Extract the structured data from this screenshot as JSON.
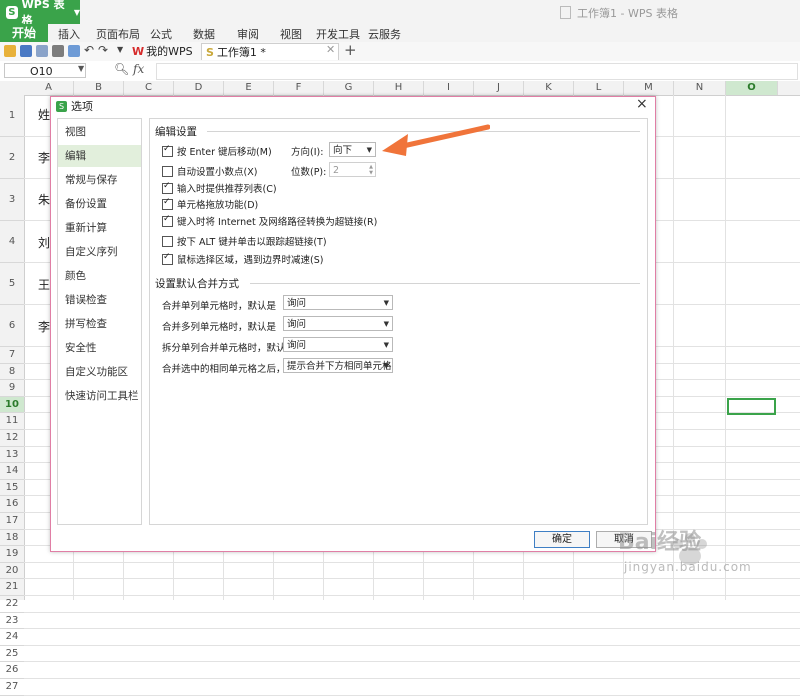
{
  "app": {
    "name": "WPS 表格",
    "window_title": "工作簿1 - WPS 表格"
  },
  "ribbon": {
    "tabs": [
      "开始",
      "插入",
      "页面布局",
      "公式",
      "数据",
      "审阅",
      "视图",
      "开发工具",
      "云服务"
    ]
  },
  "doc_tabs": {
    "my_wps": "我的WPS",
    "book": "工作簿1 *",
    "add": "+"
  },
  "formula_bar": {
    "name_box": "O10",
    "fx": "fx",
    "value": ""
  },
  "sheet": {
    "columns": [
      "A",
      "B",
      "C",
      "D",
      "E",
      "F",
      "G",
      "H",
      "I",
      "J",
      "K",
      "L",
      "M",
      "N",
      "O"
    ],
    "selected_column": "O",
    "rows": [
      "1",
      "2",
      "3",
      "4",
      "5",
      "6",
      "7",
      "8",
      "9",
      "10",
      "11",
      "12",
      "13",
      "14",
      "15",
      "16",
      "17",
      "18",
      "19",
      "20",
      "21",
      "22",
      "23",
      "24",
      "25",
      "26",
      "27"
    ],
    "selected_row": "10",
    "visible_cells": [
      "姓",
      "李",
      "朱",
      "刘",
      "王",
      "李"
    ]
  },
  "dialog": {
    "title": "选项",
    "close": "×",
    "nav": [
      "视图",
      "编辑",
      "常规与保存",
      "备份设置",
      "重新计算",
      "自定义序列",
      "颜色",
      "错误检查",
      "拼写检查",
      "安全性",
      "自定义功能区",
      "快速访问工具栏"
    ],
    "selected_nav": "编辑",
    "edit_section": {
      "title": "编辑设置",
      "options": [
        {
          "label": "按 Enter 键后移动(M)",
          "checked": true
        },
        {
          "label": "自动设置小数点(X)",
          "checked": false
        },
        {
          "label": "输入时提供推荐列表(C)",
          "checked": true
        },
        {
          "label": "单元格拖放功能(D)",
          "checked": true
        },
        {
          "label": "键入时将 Internet 及网络路径转换为超链接(R)",
          "checked": true
        },
        {
          "label": "按下 ALT 键并单击以跟踪超链接(T)",
          "checked": false
        },
        {
          "label": "鼠标选择区域，遇到边界时减速(S)",
          "checked": true
        }
      ],
      "direction_label": "方向(I):",
      "direction_value": "向下",
      "places_label": "位数(P):",
      "places_value": "2"
    },
    "merge_section": {
      "title": "设置默认合并方式",
      "rows": [
        {
          "label": "合并单列单元格时，默认是",
          "value": "询问"
        },
        {
          "label": "合并多列单元格时，默认是",
          "value": "询问"
        },
        {
          "label": "拆分单列合并单元格时，默认是",
          "value": "询问"
        },
        {
          "label": "合并选中的相同单元格之后，",
          "value": "提示合并下方相同单元格"
        }
      ]
    },
    "buttons": {
      "ok": "确定",
      "cancel": "取消"
    }
  },
  "watermark": {
    "brand": "Bai经验",
    "url": "jingyan.baidu.com"
  },
  "colors": {
    "accent": "#3aa34a",
    "annotation_arrow": "#f0743a",
    "dialog_border": "#e07ea5"
  }
}
